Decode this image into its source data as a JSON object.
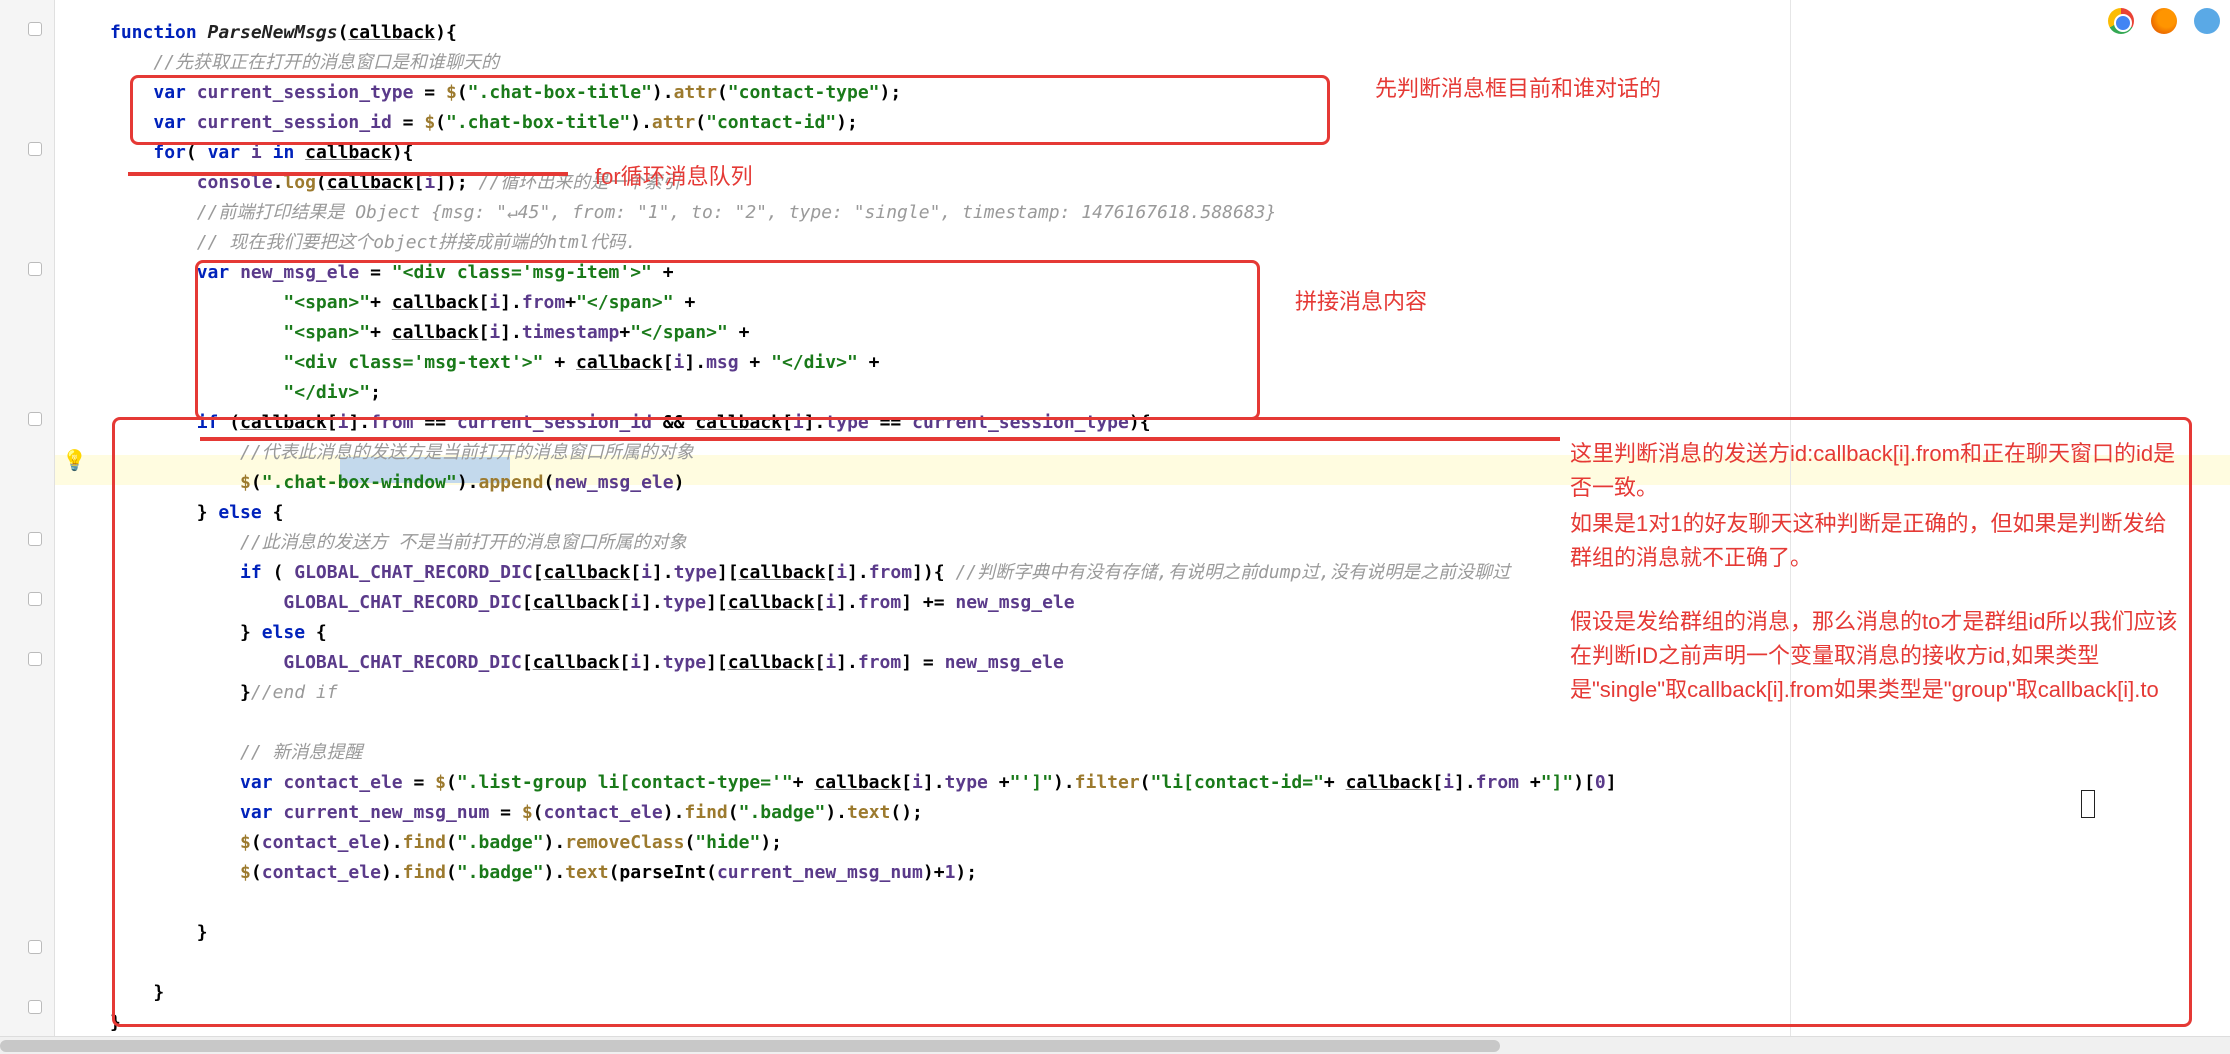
{
  "anno_top": "先判断消息框目前和谁对话的",
  "anno_for": "for循环消息队列",
  "anno_splice": "拼接消息内容",
  "anno_right_1": "这里判断消息的发送方id:callback[i].from和正在聊天窗口的id是否一致。",
  "anno_right_2": "如果是1对1的好友聊天这种判断是正确的，但如果是判断发给群组的消息就不正确了。",
  "anno_right_3": "假设是发给群组的消息，那么消息的to才是群组id所以我们应该在判断ID之前声明一个变量取消息的接收方id,如果类型是\"single\"取callback[i].from如果类型是\"group\"取callback[i].to",
  "code": {
    "l1": "function ParseNewMsgs(callback){",
    "l2": "    //先获取正在打开的消息窗口是和谁聊天的",
    "l3": "    var current_session_type = $(\".chat-box-title\").attr(\"contact-type\");",
    "l4": "    var current_session_id = $(\".chat-box-title\").attr(\"contact-id\");",
    "l5": "    for( var i in callback){",
    "l6": "        console.log(callback[i]); //循环出来的是一个索引",
    "l7": "        //前端打印结果是 Object {msg: \"↵45\", from: \"1\", to: \"2\", type: \"single\", timestamp: 1476167618.588683}",
    "l8": "        // 现在我们要把这个object拼接成前端的html代码.",
    "l9": "        var new_msg_ele = \"<div class='msg-item'>\" +",
    "l10": "                \"<span>\"+ callback[i].from+\"</span>\" +",
    "l11": "                \"<span>\"+ callback[i].timestamp+\"</span>\" +",
    "l12": "                \"<div class='msg-text'>\" + callback[i].msg + \"</div>\" +",
    "l13": "                \"</div>\";",
    "l14": "        if (callback[i].from == current_session_id && callback[i].type == current_session_type){",
    "l15": "            //代表此消息的发送方是当前打开的消息窗口所属的对象",
    "l16": "            $(\".chat-box-window\").append(new_msg_ele)",
    "l17": "        } else {",
    "l18": "            //此消息的发送方 不是当前打开的消息窗口所属的对象",
    "l19": "            if ( GLOBAL_CHAT_RECORD_DIC[callback[i].type][callback[i].from]){ //判断字典中有没有存储,有说明之前dump过,没有说明是之前没聊过",
    "l20": "                GLOBAL_CHAT_RECORD_DIC[callback[i].type][callback[i].from] += new_msg_ele",
    "l21": "            } else {",
    "l22": "                GLOBAL_CHAT_RECORD_DIC[callback[i].type][callback[i].from] = new_msg_ele",
    "l23": "            }//end if",
    "l24": "",
    "l25": "            // 新消息提醒",
    "l26": "            var contact_ele = $(\".list-group li[contact-type='\"+ callback[i].type +\"']\").filter(\"li[contact-id=\"+ callback[i].from +\"]\")[0]",
    "l27": "            var current_new_msg_num = $(contact_ele).find(\".badge\").text();",
    "l28": "            $(contact_ele).find(\".badge\").removeClass(\"hide\");",
    "l29": "            $(contact_ele).find(\".badge\").text(parseInt(current_new_msg_num)+1);",
    "l30": "",
    "l31": "        }",
    "l32": "",
    "l33": "    }",
    "l34": "}"
  }
}
